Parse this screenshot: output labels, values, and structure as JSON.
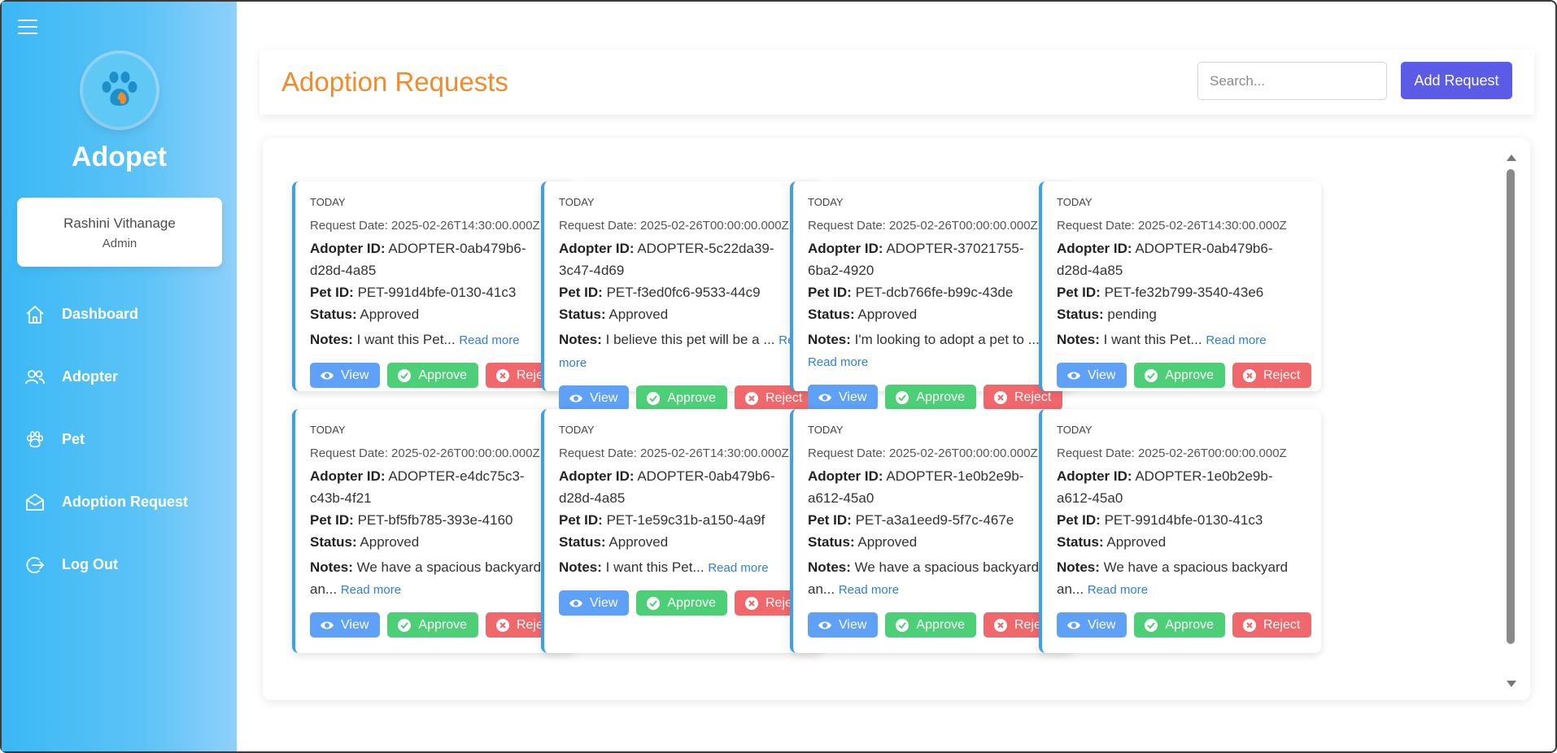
{
  "sidebar": {
    "brand": "Adopet",
    "user": {
      "name": "Rashini Vithanage",
      "role": "Admin"
    },
    "nav": [
      {
        "label": "Dashboard",
        "icon": "home-icon"
      },
      {
        "label": "Adopter",
        "icon": "users-icon"
      },
      {
        "label": "Pet",
        "icon": "paw-icon"
      },
      {
        "label": "Adoption Request",
        "icon": "envelope-open-icon"
      },
      {
        "label": "Log Out",
        "icon": "logout-icon"
      }
    ]
  },
  "header": {
    "title": "Adoption Requests",
    "search_placeholder": "Search...",
    "add_button": "Add Request"
  },
  "labels": {
    "adopter_id": "Adopter ID:",
    "pet_id": "Pet ID:",
    "status": "Status:",
    "notes": "Notes:",
    "read_more": "Read more",
    "view": "View",
    "approve": "Approve",
    "reject": "Reject"
  },
  "colors": {
    "accent_title": "#f28c2a",
    "primary_button": "#5b5be8",
    "view": "#5ea1f6",
    "approve": "#4dcf78",
    "reject": "#f0686b",
    "card_border": "#3aa0e8"
  },
  "requests": [
    {
      "day": "TODAY",
      "request_date": "Request Date: 2025-02-26T14:30:00.000Z",
      "adopter_id_1": "ADOPTER-0ab479b6-",
      "adopter_id_2": "d28d-4a85",
      "pet_id": "PET-991d4bfe-0130-41c3",
      "status": "Approved",
      "notes_1": "I want this Pet...",
      "notes_2": ""
    },
    {
      "day": "TODAY",
      "request_date": "Request Date: 2025-02-26T00:00:00.000Z",
      "adopter_id_1": "ADOPTER-5c22da39-",
      "adopter_id_2": "3c47-4d69",
      "pet_id": "PET-f3ed0fc6-9533-44c9",
      "status": "Approved",
      "notes_1": "I believe this pet will be a ...",
      "notes_2": ""
    },
    {
      "day": "TODAY",
      "request_date": "Request Date: 2025-02-26T00:00:00.000Z",
      "adopter_id_1": "ADOPTER-37021755-",
      "adopter_id_2": "6ba2-4920",
      "pet_id": "PET-dcb766fe-b99c-43de",
      "status": "Approved",
      "notes_1": "I'm looking to adopt a pet to ...",
      "notes_2": ""
    },
    {
      "day": "TODAY",
      "request_date": "Request Date: 2025-02-26T14:30:00.000Z",
      "adopter_id_1": "ADOPTER-0ab479b6-",
      "adopter_id_2": "d28d-4a85",
      "pet_id": "PET-fe32b799-3540-43e6",
      "status": "pending",
      "notes_1": "I want this Pet...",
      "notes_2": ""
    },
    {
      "day": "TODAY",
      "request_date": "Request Date: 2025-02-26T00:00:00.000Z",
      "adopter_id_1": "ADOPTER-e4dc75c3-",
      "adopter_id_2": "c43b-4f21",
      "pet_id": "PET-bf5fb785-393e-4160",
      "status": "Approved",
      "notes_1": "We have a spacious backyard",
      "notes_2": "an..."
    },
    {
      "day": "TODAY",
      "request_date": "Request Date: 2025-02-26T14:30:00.000Z",
      "adopter_id_1": "ADOPTER-0ab479b6-",
      "adopter_id_2": "d28d-4a85",
      "pet_id": "PET-1e59c31b-a150-4a9f",
      "status": "Approved",
      "notes_1": "I want this Pet...",
      "notes_2": ""
    },
    {
      "day": "TODAY",
      "request_date": "Request Date: 2025-02-26T00:00:00.000Z",
      "adopter_id_1": "ADOPTER-1e0b2e9b-",
      "adopter_id_2": "a612-45a0",
      "pet_id": "PET-a3a1eed9-5f7c-467e",
      "status": "Approved",
      "notes_1": "We have a spacious backyard",
      "notes_2": "an..."
    },
    {
      "day": "TODAY",
      "request_date": "Request Date: 2025-02-26T00:00:00.000Z",
      "adopter_id_1": "ADOPTER-1e0b2e9b-",
      "adopter_id_2": "a612-45a0",
      "pet_id": "PET-991d4bfe-0130-41c3",
      "status": "Approved",
      "notes_1": "We have a spacious backyard",
      "notes_2": "an..."
    }
  ]
}
